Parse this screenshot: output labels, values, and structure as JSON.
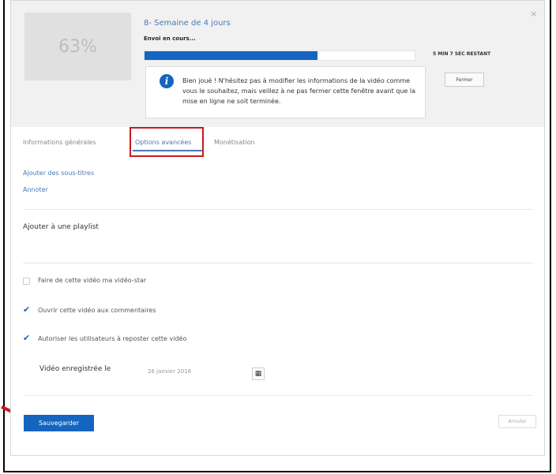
{
  "upload": {
    "percent_label": "63%",
    "progress": 0.64,
    "video_title": "8- Semaine de 4 jours",
    "status": "Envoi en cours...",
    "time_remaining": "5 MIN 7 SEC RESTANT",
    "close_icon": "×",
    "info_message": "Bien joué ! N'hésitez pas à modifier les informations de la vidéo comme vous le souhaitez, mais veillez à ne pas fermer cette fenêtre avant que la mise en ligne ne soit terminée.",
    "dismiss_label": "Fermer"
  },
  "tabs": [
    {
      "label": "Informations générales"
    },
    {
      "label": "Options avancées"
    },
    {
      "label": "Monétisation"
    }
  ],
  "advanced": {
    "add_subtitles": "Ajouter des sous-titres",
    "annotate": "Annoter",
    "playlist_label": "Ajouter à une playlist",
    "checkboxes": [
      {
        "label": "Faire de cette vidéo ma vidéo-star",
        "checked": false
      },
      {
        "label": "Ouvrir cette vidéo aux commentaires",
        "checked": true
      },
      {
        "label": "Autoriser les utilisateurs à reposter cette vidéo",
        "checked": true
      }
    ],
    "recorded_label": "Vidéo enregistrée le",
    "recorded_date": "26 janvier 2016"
  },
  "footer": {
    "save_label": "Sauvegarder",
    "cancel_label": "Annuler"
  },
  "colors": {
    "accent": "#1565c0",
    "highlight": "#c8191f"
  }
}
